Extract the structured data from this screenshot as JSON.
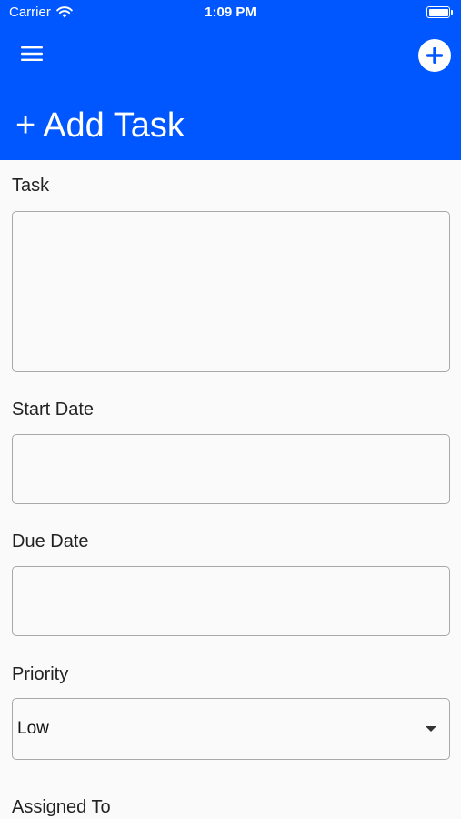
{
  "status_bar": {
    "carrier": "Carrier",
    "time": "1:09 PM"
  },
  "header": {
    "background": "#0057ff",
    "menu_icon": "hamburger-menu-icon",
    "add_icon": "plus-circle-icon",
    "title_icon": "+",
    "title": "Add Task"
  },
  "form": {
    "task": {
      "label": "Task",
      "value": ""
    },
    "start_date": {
      "label": "Start Date",
      "value": ""
    },
    "due_date": {
      "label": "Due Date",
      "value": ""
    },
    "priority": {
      "label": "Priority",
      "selected": "Low"
    },
    "assigned_to": {
      "label": "Assigned To"
    }
  }
}
